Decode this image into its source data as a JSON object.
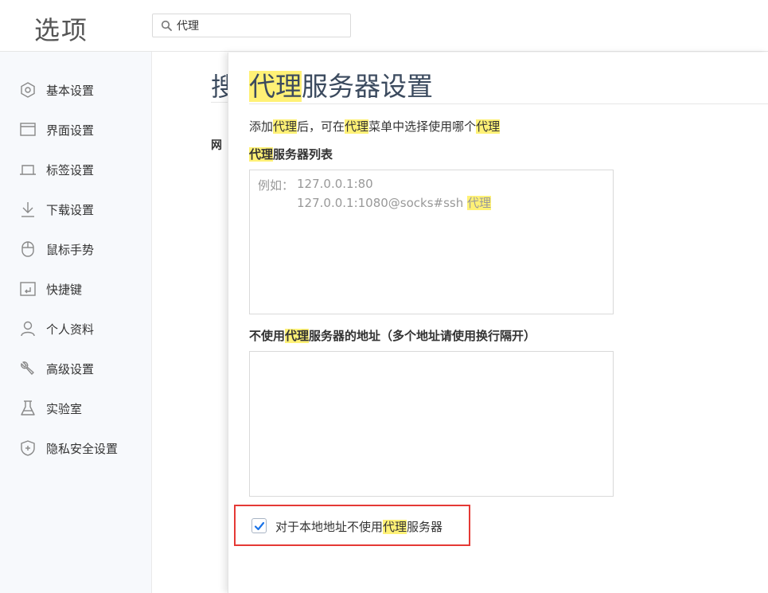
{
  "header": {
    "title": "选项",
    "search": {
      "value": "代理",
      "icon": "search-icon"
    }
  },
  "sidebar": {
    "items": [
      {
        "label": "基本设置",
        "icon": "hexagon-gear-icon"
      },
      {
        "label": "界面设置",
        "icon": "window-icon"
      },
      {
        "label": "标签设置",
        "icon": "tab-icon"
      },
      {
        "label": "下载设置",
        "icon": "download-icon"
      },
      {
        "label": "鼠标手势",
        "icon": "mouse-icon"
      },
      {
        "label": "快捷键",
        "icon": "keyboard-shortcut-icon"
      },
      {
        "label": "个人资料",
        "icon": "person-icon"
      },
      {
        "label": "高级设置",
        "icon": "wrench-icon"
      },
      {
        "label": "实验室",
        "icon": "flask-icon"
      },
      {
        "label": "隐私安全设置",
        "icon": "shield-plus-icon"
      }
    ]
  },
  "background_page": {
    "heading_partial": "搜",
    "label_partial": "网"
  },
  "panel": {
    "title_highlight": "代理",
    "title_rest": "服务器设置",
    "description": {
      "p1": "添加",
      "h1": "代理",
      "p2": "后，可在",
      "h2": "代理",
      "p3": "菜单中选择使用哪个",
      "h3": "代理"
    },
    "server_list": {
      "label_highlight": "代理",
      "label_rest": "服务器列表",
      "placeholder_prefix": "例如：",
      "placeholder_line1": "127.0.0.1:80",
      "placeholder_line2": "127.0.0.1:1080@socks#ssh",
      "placeholder_line2_highlight": "代理"
    },
    "bypass_list": {
      "label_prefix": "不使用",
      "label_highlight": "代理",
      "label_rest": "服务器的地址（多个地址请使用换行隔开）",
      "value": ""
    },
    "local_bypass": {
      "checked": true,
      "label_prefix": "对于本地地址不使用",
      "label_highlight": "代理",
      "label_rest": "服务器"
    }
  },
  "colors": {
    "highlight": "#fff176",
    "annotation_box": "#e53935",
    "checkbox_check": "#1a73e8",
    "title_text": "#3b4a5e"
  }
}
